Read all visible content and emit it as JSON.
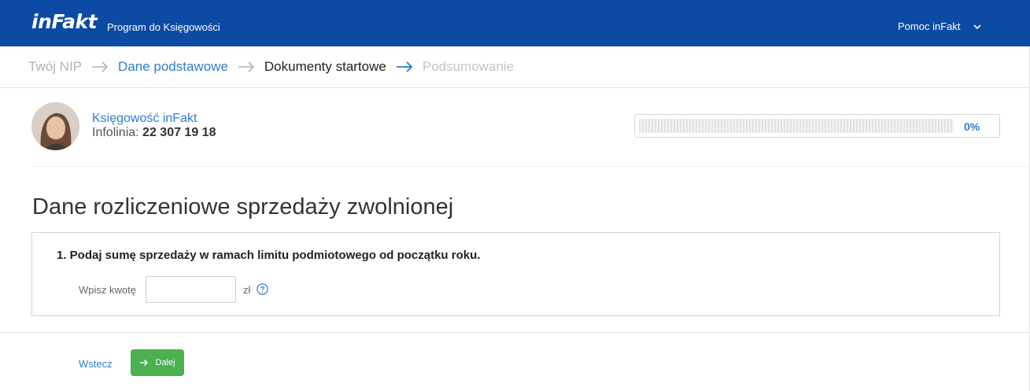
{
  "header": {
    "logo": "inFakt",
    "app_name": "Program do Księgowości",
    "help_label": "Pomoc inFakt"
  },
  "stepper": {
    "steps": [
      {
        "label": "Twój NIP",
        "state": "done"
      },
      {
        "label": "Dane podstawowe",
        "state": "link"
      },
      {
        "label": "Dokumenty startowe",
        "state": "current"
      },
      {
        "label": "Podsumowanie",
        "state": "future"
      }
    ]
  },
  "contact": {
    "name": "Księgowość inFakt",
    "phone_label": "Infolinia:",
    "phone_number": "22 307 19 18"
  },
  "progress": {
    "value": 0,
    "label": "0%"
  },
  "page_title": "Dane rozliczeniowe sprzedaży zwolnionej",
  "form": {
    "question": "1. Podaj sumę sprzedaży w ramach limitu podmiotowego od początku roku.",
    "amount_label": "Wpisz kwotę",
    "amount_value": "",
    "currency": "zł"
  },
  "footer": {
    "back_label": "Wstecz",
    "next_label": "Dalej"
  },
  "colors": {
    "brand_blue": "#0d4aa3",
    "link_blue": "#2f7cd1",
    "success_green": "#4caf50"
  }
}
